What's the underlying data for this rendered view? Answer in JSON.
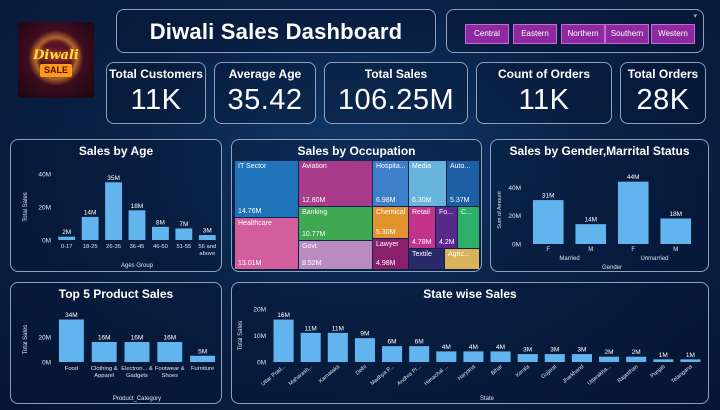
{
  "logo": {
    "line1": "Diwali",
    "line2": "SALE"
  },
  "header": {
    "title": "Diwali Sales Dashboard"
  },
  "regions": [
    "Central",
    "Eastern",
    "Northern",
    "Southern",
    "Western"
  ],
  "kpis": [
    {
      "label": "Total Customers",
      "value": "11K"
    },
    {
      "label": "Average Age",
      "value": "35.42"
    },
    {
      "label": "Total Sales",
      "value": "106.25M"
    },
    {
      "label": "Count of Orders",
      "value": "11K"
    },
    {
      "label": "Total Orders",
      "value": "28K"
    }
  ],
  "colors": {
    "bar": "#62b4ee",
    "region_button": "#8e2aa0"
  },
  "sales_by_age": {
    "title": "Sales by Age",
    "chart_data": {
      "type": "bar",
      "title": "Sales by Age",
      "xlabel": "Ages Group",
      "ylabel": "Total Sales",
      "categories": [
        "0-17",
        "18-25",
        "26-35",
        "36-45",
        "46-50",
        "51-55",
        "56 and above"
      ],
      "values": [
        2,
        14,
        35,
        18,
        8,
        7,
        3
      ],
      "value_labels": [
        "2M",
        "14M",
        "35M",
        "18M",
        "8M",
        "7M",
        "3M"
      ],
      "y_ticks": [
        "0M",
        "20M",
        "40M"
      ],
      "ylim": [
        0,
        40
      ]
    }
  },
  "sales_by_occupation": {
    "title": "Sales by Occupation",
    "chart_data": {
      "type": "treemap",
      "title": "Sales by Occupation",
      "cells": [
        {
          "name": "IT Sector",
          "value": "14.76M",
          "color": "#1f73b8"
        },
        {
          "name": "Healthcare",
          "value": "13.01M",
          "color": "#d35e9e"
        },
        {
          "name": "Aviation",
          "value": "12.80M",
          "color": "#a83a8a"
        },
        {
          "name": "Banking",
          "value": "10.77M",
          "color": "#3ea852"
        },
        {
          "name": "Govt",
          "value": "8.52M",
          "color": "#b98bc0"
        },
        {
          "name": "Hospita...",
          "value": "6.98M",
          "color": "#3d7fc9"
        },
        {
          "name": "Media",
          "value": "6.30M",
          "color": "#67b4dd"
        },
        {
          "name": "Auto...",
          "value": "5.37M",
          "color": "#1c5fa3"
        },
        {
          "name": "Chemical",
          "value": "5.30M",
          "color": "#e0932f"
        },
        {
          "name": "Lawyer",
          "value": "4.98M",
          "color": "#8a1f6c"
        },
        {
          "name": "Retail",
          "value": "4.78M",
          "color": "#c2338c"
        },
        {
          "name": "Fo...",
          "value": "4.2M",
          "color": "#5a2a8a"
        },
        {
          "name": "C...",
          "value": "",
          "color": "#2fb06a"
        },
        {
          "name": "Textile",
          "value": "",
          "color": "#2a2a6a"
        },
        {
          "name": "Agric...",
          "value": "",
          "color": "#d9b25a"
        }
      ]
    }
  },
  "sales_by_gender": {
    "title": "Sales by Gender,Marrital Status",
    "chart_data": {
      "type": "bar",
      "title": "Sales by Gender,Marrital Status",
      "xlabel": "Gender",
      "ylabel": "Sum of Amount",
      "groups": [
        "Married",
        "Unmarried"
      ],
      "categories": [
        "F",
        "M",
        "F",
        "M"
      ],
      "values": [
        31,
        14,
        44,
        18
      ],
      "value_labels": [
        "31M",
        "14M",
        "44M",
        "18M"
      ],
      "y_ticks": [
        "0M",
        "20M",
        "40M"
      ],
      "ylim": [
        0,
        48
      ]
    }
  },
  "top_products": {
    "title": "Top 5 Product Sales",
    "chart_data": {
      "type": "bar",
      "title": "Top 5 Product Sales",
      "xlabel": "Product_Category",
      "ylabel": "Total Sales",
      "categories": [
        "Food",
        "Clothing & Apparel",
        "Electron... & Gadgets",
        "Footwear & Shoes",
        "Furniture"
      ],
      "values": [
        34,
        16,
        16,
        16,
        5
      ],
      "value_labels": [
        "34M",
        "16M",
        "16M",
        "16M",
        "5M"
      ],
      "y_ticks": [
        "0M",
        "20M"
      ],
      "ylim": [
        0,
        36
      ]
    }
  },
  "state_sales": {
    "title": "State wise Sales",
    "chart_data": {
      "type": "bar",
      "title": "State wise Sales",
      "xlabel": "State",
      "ylabel": "Total Sales",
      "categories": [
        "Uttar Prad...",
        "Maharash...",
        "Karnataka",
        "Delhi",
        "Madhya P...",
        "Andhra Pr...",
        "Himachal ...",
        "Haryana",
        "Bihar",
        "Kerala",
        "Gujarat",
        "Jharkhand",
        "Uttarakha...",
        "Rajasthan",
        "Punjab",
        "Telangana"
      ],
      "values": [
        16,
        11,
        11,
        9,
        6,
        6,
        4,
        4,
        4,
        3,
        3,
        3,
        2,
        2,
        1,
        1
      ],
      "value_labels": [
        "16M",
        "11M",
        "11M",
        "9M",
        "6M",
        "6M",
        "4M",
        "4M",
        "4M",
        "3M",
        "3M",
        "3M",
        "2M",
        "2M",
        "1M",
        "1M"
      ],
      "y_ticks": [
        "0M",
        "10M",
        "20M"
      ],
      "ylim": [
        0,
        20
      ]
    }
  }
}
